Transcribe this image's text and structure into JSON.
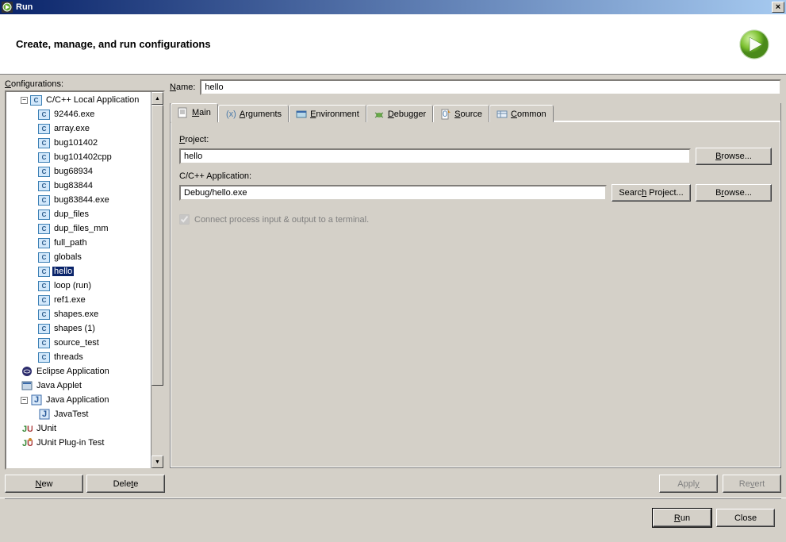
{
  "window": {
    "title": "Run",
    "close_label": "×"
  },
  "header": {
    "title": "Create, manage, and run configurations"
  },
  "sidebar": {
    "label": "Configurations:",
    "new_button": "New",
    "delete_button": "Delete",
    "items": [
      {
        "label": "C/C++ Local Application",
        "icon": "c",
        "expanded": true,
        "level": 0,
        "hasChildren": true
      },
      {
        "label": "92446.exe",
        "icon": "c",
        "level": 1
      },
      {
        "label": "array.exe",
        "icon": "c",
        "level": 1
      },
      {
        "label": "bug101402",
        "icon": "c",
        "level": 1
      },
      {
        "label": "bug101402cpp",
        "icon": "c",
        "level": 1
      },
      {
        "label": "bug68934",
        "icon": "c",
        "level": 1
      },
      {
        "label": "bug83844",
        "icon": "c",
        "level": 1
      },
      {
        "label": "bug83844.exe",
        "icon": "c",
        "level": 1
      },
      {
        "label": "dup_files",
        "icon": "c",
        "level": 1
      },
      {
        "label": "dup_files_mm",
        "icon": "c",
        "level": 1
      },
      {
        "label": "full_path",
        "icon": "c",
        "level": 1
      },
      {
        "label": "globals",
        "icon": "c",
        "level": 1
      },
      {
        "label": "hello",
        "icon": "c",
        "level": 1,
        "selected": true
      },
      {
        "label": "loop (run)",
        "icon": "c",
        "level": 1
      },
      {
        "label": "ref1.exe",
        "icon": "c",
        "level": 1
      },
      {
        "label": "shapes.exe",
        "icon": "c",
        "level": 1
      },
      {
        "label": "shapes (1)",
        "icon": "c",
        "level": 1
      },
      {
        "label": "source_test",
        "icon": "c",
        "level": 1
      },
      {
        "label": "threads",
        "icon": "c",
        "level": 1
      },
      {
        "label": "Eclipse Application",
        "icon": "eclipse",
        "level": 0
      },
      {
        "label": "Java Applet",
        "icon": "applet",
        "level": 0
      },
      {
        "label": "Java Application",
        "icon": "java",
        "level": 0,
        "expanded": true,
        "hasChildren": true
      },
      {
        "label": "JavaTest",
        "icon": "java",
        "level": 1
      },
      {
        "label": "JUnit",
        "icon": "junit",
        "level": 0
      },
      {
        "label": "JUnit Plug-in Test",
        "icon": "junit-plugin",
        "level": 0
      }
    ]
  },
  "main": {
    "name_label": "Name:",
    "name_value": "hello",
    "tabs": [
      {
        "id": "main",
        "label": "Main",
        "icon": "main",
        "active": true
      },
      {
        "id": "arguments",
        "label": "Arguments",
        "icon": "arguments"
      },
      {
        "id": "environment",
        "label": "Environment",
        "icon": "environment"
      },
      {
        "id": "debugger",
        "label": "Debugger",
        "icon": "debugger"
      },
      {
        "id": "source",
        "label": "Source",
        "icon": "source"
      },
      {
        "id": "common",
        "label": "Common",
        "icon": "common"
      }
    ],
    "project_label": "Project:",
    "project_value": "hello",
    "project_browse": "Browse...",
    "app_label": "C/C++ Application:",
    "app_value": "Debug/hello.exe",
    "app_search": "Search Project...",
    "app_browse": "Browse...",
    "connect_checkbox_label": "Connect process input & output to a terminal.",
    "connect_checked": true,
    "apply_button": "Apply",
    "revert_button": "Revert"
  },
  "footer": {
    "run_button": "Run",
    "close_button": "Close"
  }
}
